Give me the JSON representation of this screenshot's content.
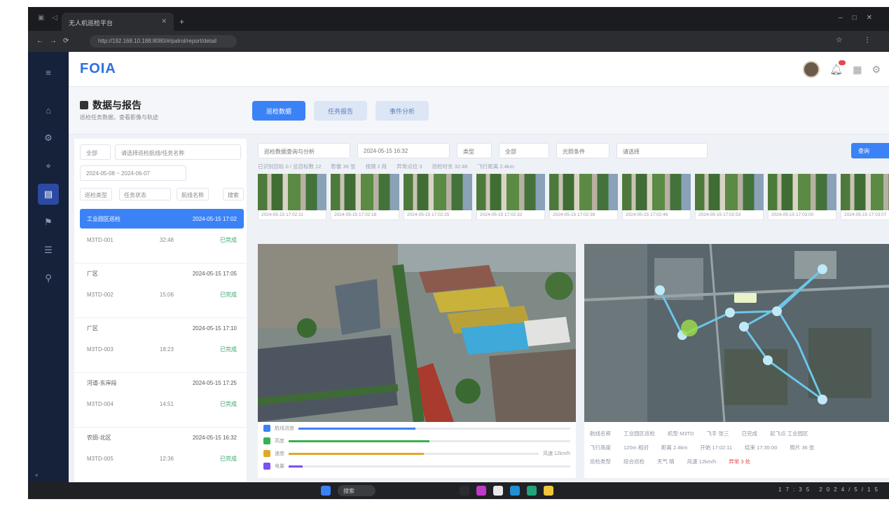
{
  "browser": {
    "tab_title": "无人机巡检平台",
    "url": "http://192.168.10.188:8080/#/patrol/report/detail"
  },
  "app": {
    "logo": "FOIA",
    "page_title": "数据与报告",
    "page_subtitle": "巡检任务数据，查看影像与轨迹",
    "mode_tabs": [
      "巡检数据",
      "任务报告",
      "事件分析"
    ],
    "left_panel": {
      "org_select": "全部",
      "route_select": "请选择巡检航线/任务名称",
      "date_range": "2024-05-08 ~ 2024-06-07",
      "filters": [
        "巡检类型",
        "任务状态",
        "航线名称",
        "搜索"
      ],
      "tasks": [
        {
          "name": "工业园区巡检",
          "time": "2024-05-15 17:02",
          "device": "M3TD-001",
          "dur": "32:48",
          "status": "已完成",
          "selected": true
        },
        {
          "name": "厂区",
          "time": "2024-05-15 17:05",
          "device": "M3TD-002",
          "dur": "15:06",
          "status": "已完成",
          "selected": false
        },
        {
          "name": "厂区",
          "time": "2024-05-15 17:10",
          "device": "M3TD-003",
          "dur": "18:23",
          "status": "已完成",
          "selected": false
        },
        {
          "name": "河道-东岸段",
          "time": "2024-05-15 17:25",
          "device": "M3TD-004",
          "dur": "14:51",
          "status": "已完成",
          "selected": false
        },
        {
          "name": "农田-北区",
          "time": "2024-05-15 16:32",
          "device": "M3TD-005",
          "dur": "12:36",
          "status": "已完成",
          "selected": false
        }
      ]
    },
    "main": {
      "filters": [
        "巡检数据查询与分析",
        "2024-05-15 16:32",
        "类型",
        "全部",
        "光照条件",
        "请选择"
      ],
      "query_label": "查询",
      "tags": [
        "已识别目标 0 / 总目标数 12",
        "影像 36 张",
        "视频 2 段",
        "异常点位 3",
        "巡检时长 32:48",
        "飞行距离 2.4km"
      ],
      "thumbs": [
        "2024-05-15 17:02:11",
        "2024-05-15 17:02:18",
        "2024-05-15 17:02:25",
        "2024-05-15 17:02:32",
        "2024-05-15 17:02:39",
        "2024-05-15 17:02:46",
        "2024-05-15 17:02:53",
        "2024-05-15 17:03:00",
        "2024-05-15 17:03:07"
      ],
      "bars": [
        {
          "label": "航线进度",
          "fill": 0.43,
          "color": "#3b82f6",
          "note": ""
        },
        {
          "label": "高度",
          "fill": 0.5,
          "color": "#37b24d",
          "note": ""
        },
        {
          "label": "速度",
          "fill": 0.54,
          "color": "#e0a72b",
          "note": "风速 12km/h"
        },
        {
          "label": "电量",
          "fill": 0.05,
          "color": "#7950f2",
          "note": ""
        }
      ],
      "meta_rows": [
        [
          "航线名称",
          "工业园区巡检",
          "机型 M3TD",
          "飞手 张三",
          "已完成",
          "起飞点 工业园区"
        ],
        [
          "飞行高度",
          "120m 相对",
          "距离 2.4km",
          "开始 17:02:11",
          "结束 17:35:00",
          "照片 36 张"
        ],
        [
          "巡检类型",
          "综合巡检",
          "天气 晴",
          "风速 12km/h",
          "异常 3 处"
        ]
      ]
    }
  },
  "taskbar": {
    "search": "搜索",
    "clock": "17:35 2024/5/15"
  },
  "colors": {
    "accent": "#3b82f6",
    "rail_bg": "#16213a"
  }
}
